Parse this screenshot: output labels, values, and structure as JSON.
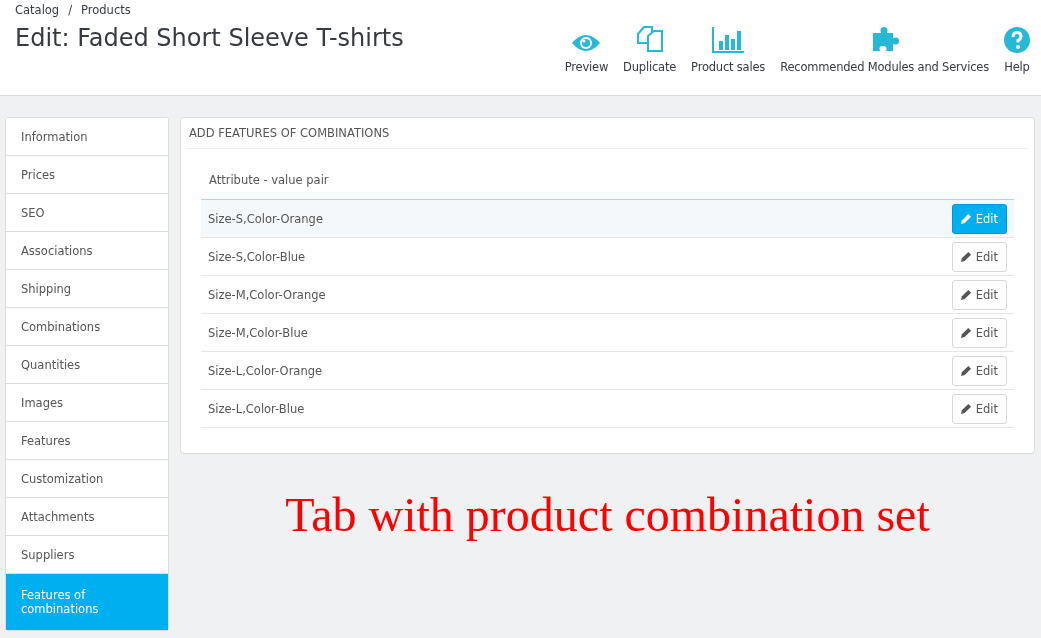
{
  "breadcrumb": [
    "Catalog",
    "/",
    "Products"
  ],
  "page_title": "Edit: Faded Short Sleeve T-shirts",
  "toolbar": [
    {
      "kind": "eye",
      "label": "Preview"
    },
    {
      "kind": "copy",
      "label": "Duplicate"
    },
    {
      "kind": "chart",
      "label": "Product sales"
    },
    {
      "kind": "puzzle",
      "label": "Recommended Modules and Services"
    },
    {
      "kind": "help",
      "label": "Help"
    }
  ],
  "sidebar": {
    "items": [
      {
        "label": "Information",
        "selected": false
      },
      {
        "label": "Prices",
        "selected": false
      },
      {
        "label": "SEO",
        "selected": false
      },
      {
        "label": "Associations",
        "selected": false
      },
      {
        "label": "Shipping",
        "selected": false
      },
      {
        "label": "Combinations",
        "selected": false
      },
      {
        "label": "Quantities",
        "selected": false
      },
      {
        "label": "Images",
        "selected": false
      },
      {
        "label": "Features",
        "selected": false
      },
      {
        "label": "Customization",
        "selected": false
      },
      {
        "label": "Attachments",
        "selected": false
      },
      {
        "label": "Suppliers",
        "selected": false
      },
      {
        "label": "Features of combinations",
        "selected": true
      }
    ]
  },
  "panel": {
    "title": "ADD FEATURES OF COMBINATIONS",
    "table": {
      "columns": [
        "Attribute - value pair"
      ],
      "rows": [
        {
          "pair": "Size-S,Color-Orange",
          "button": "Edit",
          "selected": true
        },
        {
          "pair": "Size-S,Color-Blue",
          "button": "Edit",
          "selected": false
        },
        {
          "pair": "Size-M,Color-Orange",
          "button": "Edit",
          "selected": false
        },
        {
          "pair": "Size-M,Color-Blue",
          "button": "Edit",
          "selected": false
        },
        {
          "pair": "Size-L,Color-Orange",
          "button": "Edit",
          "selected": false
        },
        {
          "pair": "Size-L,Color-Blue",
          "button": "Edit",
          "selected": false
        }
      ]
    }
  },
  "annotation": "Tab with product combination set"
}
